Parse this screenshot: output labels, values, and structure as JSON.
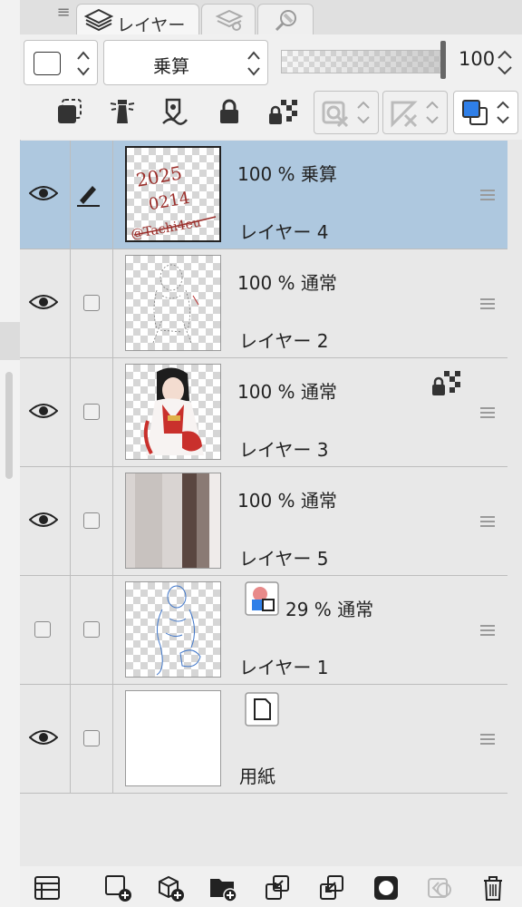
{
  "tabs": [
    {
      "label": "レイヤー",
      "active": true
    },
    {
      "label": "",
      "active": false
    },
    {
      "label": "",
      "active": false
    }
  ],
  "toolbar": {
    "blend_mode": "乗算",
    "opacity": "100"
  },
  "icons": {
    "menu": "hamburger-icon",
    "layers": "layers-icon",
    "colors": "color-icon"
  },
  "layers": [
    {
      "pct": "100 %",
      "mode": "乗算",
      "name": "レイヤー 4",
      "selected": true,
      "visible": true,
      "editing": true
    },
    {
      "pct": "100 %",
      "mode": "通常",
      "name": "レイヤー 2",
      "selected": false,
      "visible": true,
      "editing": false
    },
    {
      "pct": "100 %",
      "mode": "通常",
      "name": "レイヤー 3",
      "selected": false,
      "visible": true,
      "editing": false,
      "alpha_locked": true
    },
    {
      "pct": "100 %",
      "mode": "通常",
      "name": "レイヤー 5",
      "selected": false,
      "visible": true,
      "editing": false
    },
    {
      "pct": "29 %",
      "mode": "通常",
      "name": "レイヤー 1",
      "selected": false,
      "visible": false,
      "editing": false,
      "color_layer": true
    },
    {
      "pct": "",
      "mode": "",
      "name": "用紙",
      "selected": false,
      "visible": true,
      "editing": false,
      "paper": true
    }
  ],
  "thumb_text": {
    "l1": "2025",
    "l2": "0214",
    "l3": "@Tachi4eu"
  },
  "colors": {
    "selected_row": "#aec8df",
    "accent_blue": "#2f7fe8",
    "thumb_red": "#9b2e2a"
  }
}
